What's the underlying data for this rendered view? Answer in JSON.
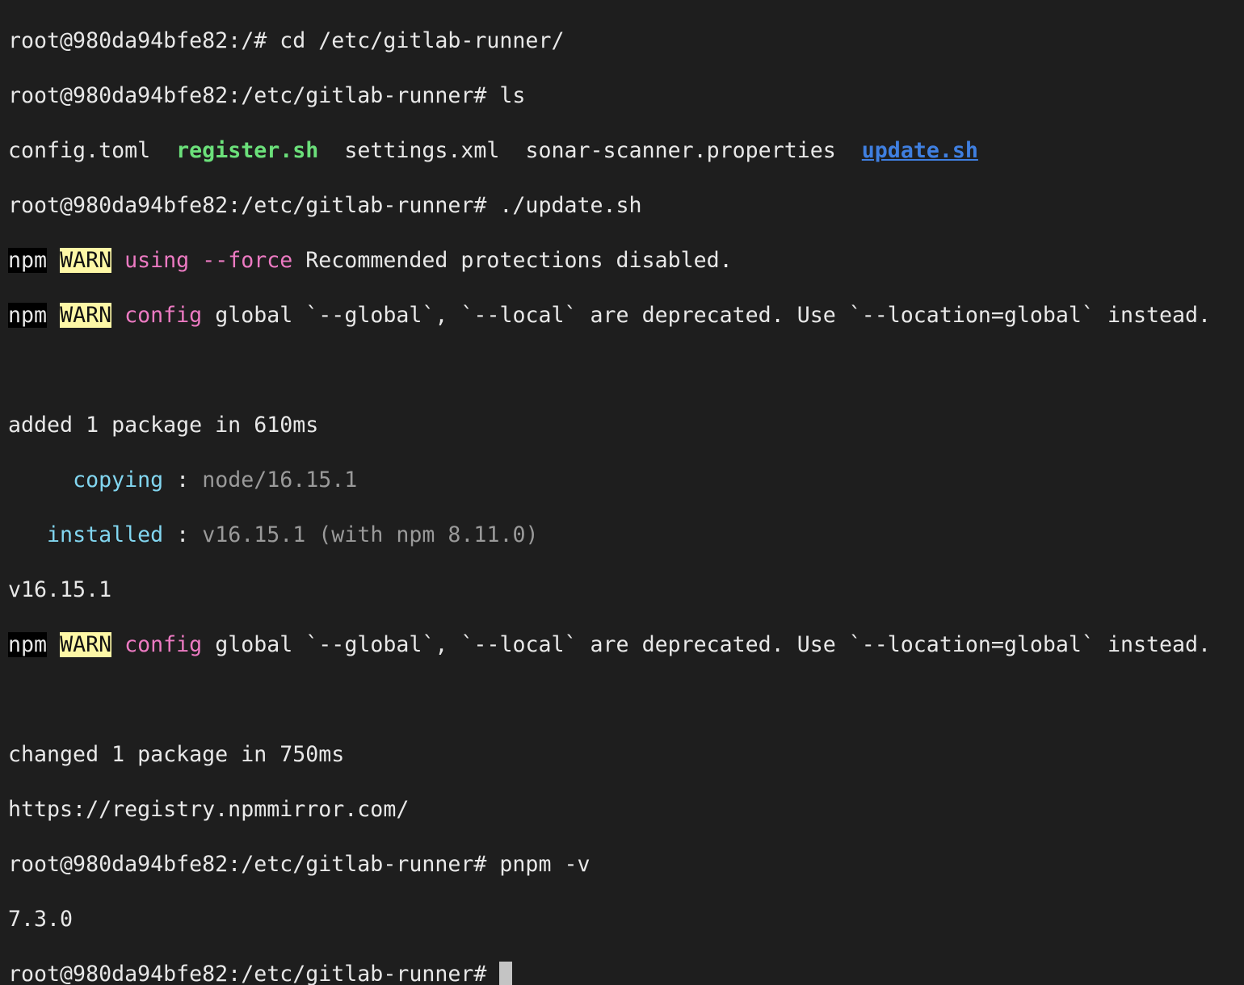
{
  "terminal": {
    "line1": "root@980da94bfe82:/# cd /etc/gitlab-runner/",
    "line2": "root@980da94bfe82:/etc/gitlab-runner# ls",
    "ls": {
      "config": "config.toml",
      "register": "register.sh",
      "settings": "settings.xml",
      "sonar": "sonar-scanner.properties",
      "update": "update.sh"
    },
    "line4": "root@980da94bfe82:/etc/gitlab-runner# ./update.sh",
    "npm": "npm",
    "warn": "WARN",
    "warn1_key": "using --force",
    "warn1_msg": " Recommended protections disabled.",
    "warn2_key": "config",
    "warn2_msg": " global `--global`, `--local` are deprecated. Use `--location=global` instead.",
    "added": "added 1 package in 610ms",
    "copying_label": "copying",
    "copying_value": "node/16.15.1",
    "installed_label": "installed",
    "installed_value": "v16.15.1 (with npm 8.11.0)",
    "version": "v16.15.1",
    "warn3_key": "config",
    "warn3_msg": " global `--global`, `--local` are deprecated. Use `--location=global` instead.",
    "changed": "changed 1 package in 750ms",
    "registry": "https://registry.npmmirror.com/",
    "pnpm_cmd": "root@980da94bfe82:/etc/gitlab-runner# pnpm -v",
    "pnpm_version": "7.3.0",
    "prompt": "root@980da94bfe82:/etc/gitlab-runner# "
  },
  "colors": {
    "background": "#1e1e1e",
    "text": "#e8e8e8",
    "executable": "#6be07a",
    "link": "#3f7fe0",
    "warn_bg": "#fdf7a6",
    "pink": "#ec7ac2",
    "cyan": "#82d6f0",
    "gray": "#9a9a9a"
  }
}
